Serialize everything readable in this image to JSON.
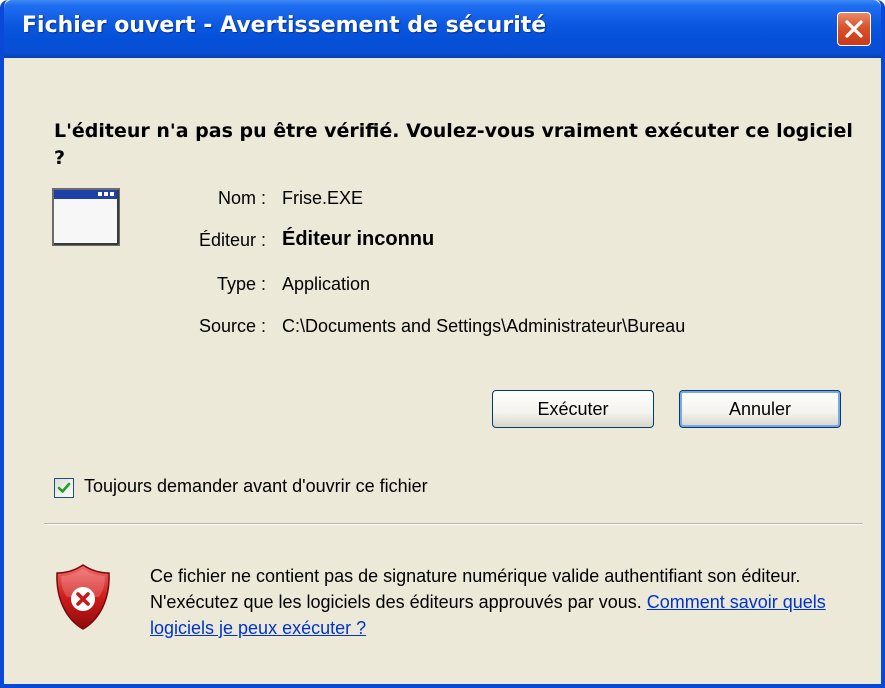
{
  "window": {
    "title": "Fichier ouvert - Avertissement de sécurité"
  },
  "heading": "L'éditeur n'a pas pu être vérifié. Voulez-vous vraiment exécuter ce logiciel ?",
  "details": {
    "name_label": "Nom :",
    "name_value": "Frise.EXE",
    "publisher_label": "Éditeur :",
    "publisher_value": "Éditeur inconnu",
    "type_label": "Type :",
    "type_value": "Application",
    "source_label": "Source :",
    "source_value": "C:\\Documents and Settings\\Administrateur\\Bureau"
  },
  "buttons": {
    "run_label": "Exécuter",
    "cancel_label": "Annuler"
  },
  "checkbox": {
    "label": "Toujours demander avant d'ouvrir ce fichier",
    "checked": true
  },
  "notice": {
    "text": "Ce fichier ne contient pas de signature numérique valide authentifiant son éditeur. N'exécutez que les logiciels des éditeurs approuvés par vous. ",
    "link_text": "Comment savoir quels logiciels je peux exécuter ?"
  },
  "icons": {
    "close": "close-icon",
    "app": "application-window-icon",
    "check": "checkmark-icon",
    "warning": "security-shield-icon"
  },
  "colors": {
    "titlebar": "#0a57e0",
    "dialog_bg": "#ece9d8",
    "close_button": "#d9532b",
    "link": "#0033cc",
    "check": "#21a121",
    "shield": "#c81818"
  }
}
